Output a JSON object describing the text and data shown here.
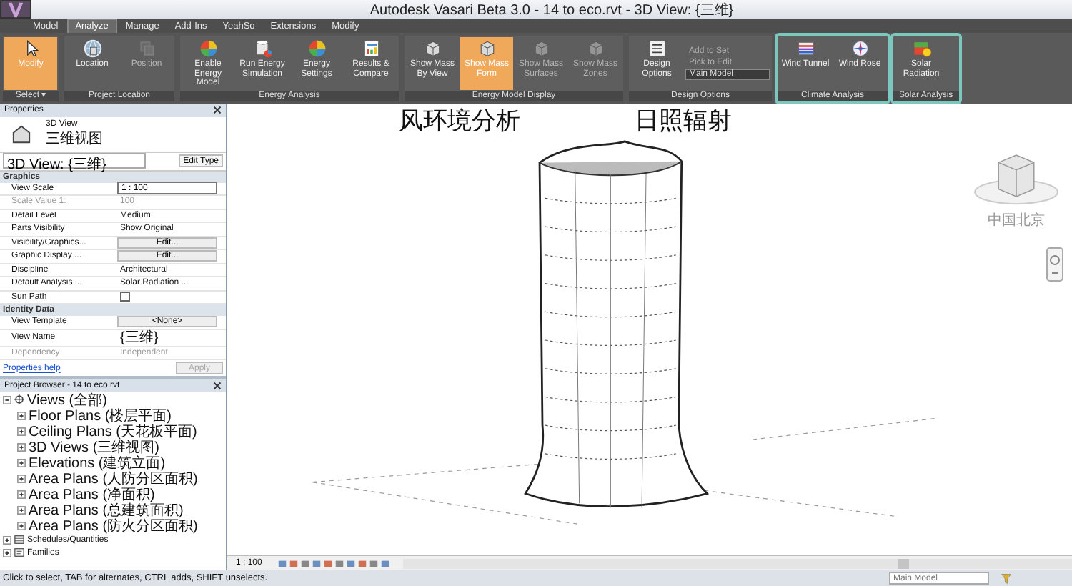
{
  "window": {
    "title": "Autodesk Vasari Beta 3.0 -     14 to eco.rvt - 3D View: {三维}"
  },
  "ribbon_tabs": [
    {
      "label": "Model",
      "selected": false
    },
    {
      "label": "Analyze",
      "selected": true
    },
    {
      "label": "Manage",
      "selected": false
    },
    {
      "label": "Add-Ins",
      "selected": false
    },
    {
      "label": "YeahSo",
      "selected": false
    },
    {
      "label": "Extensions",
      "selected": false
    },
    {
      "label": "Modify",
      "selected": false
    }
  ],
  "ribbon_panels": [
    {
      "label": "Select ▾",
      "highlighted": false,
      "buttons": [
        {
          "kind": "large",
          "label": "Modify",
          "selected": true,
          "disabled": false
        }
      ]
    },
    {
      "label": "Project Location",
      "highlighted": false,
      "buttons": [
        {
          "kind": "large",
          "label": "Location",
          "selected": false,
          "disabled": false
        },
        {
          "kind": "large",
          "label": "Position",
          "selected": false,
          "disabled": true
        }
      ]
    },
    {
      "label": "Energy Analysis",
      "highlighted": false,
      "buttons": [
        {
          "kind": "large",
          "label": "Enable Energy Model",
          "selected": false,
          "disabled": false
        },
        {
          "kind": "large",
          "label": "Run Energy Simulation",
          "selected": false,
          "disabled": false
        },
        {
          "kind": "large",
          "label": "Energy Settings",
          "selected": false,
          "disabled": false
        },
        {
          "kind": "large",
          "label": "Results & Compare",
          "selected": false,
          "disabled": false
        }
      ]
    },
    {
      "label": "Energy Model Display",
      "highlighted": false,
      "buttons": [
        {
          "kind": "large",
          "label": "Show Mass By View",
          "selected": false,
          "disabled": false
        },
        {
          "kind": "large",
          "label": "Show Mass Form",
          "selected": true,
          "disabled": false
        },
        {
          "kind": "large",
          "label": "Show Mass Surfaces",
          "selected": false,
          "disabled": true
        },
        {
          "kind": "large",
          "label": "Show Mass Zones",
          "selected": false,
          "disabled": true
        }
      ]
    },
    {
      "label": "Design Options",
      "highlighted": false,
      "buttons": [
        {
          "kind": "large",
          "label": "Design Options",
          "selected": false,
          "disabled": false
        },
        {
          "kind": "small",
          "label": "Add to Set",
          "disabled": true
        },
        {
          "kind": "small",
          "label": "Pick to Edit",
          "disabled": true
        },
        {
          "kind": "dropdown",
          "label": "Main Model"
        }
      ]
    },
    {
      "label": "Climate Analysis",
      "highlighted": true,
      "buttons": [
        {
          "kind": "large",
          "label": "Wind Tunnel",
          "selected": false,
          "disabled": false
        },
        {
          "kind": "large",
          "label": "Wind Rose",
          "selected": false,
          "disabled": false
        }
      ]
    },
    {
      "label": "Solar Analysis",
      "highlighted": true,
      "buttons": [
        {
          "kind": "large",
          "label": "Solar Radiation",
          "selected": false,
          "disabled": false
        }
      ]
    }
  ],
  "annotations": [
    {
      "text": "风环境分析"
    },
    {
      "text": "日照辐射"
    }
  ],
  "properties": {
    "title": "Properties",
    "type_name": "3D View",
    "type_subname": "三维视图",
    "instance": "3D View: {三维}",
    "edit_type": "Edit Type",
    "groups": [
      {
        "label": "Graphics",
        "rows": [
          {
            "label": "View Scale",
            "value": "1 : 100",
            "kind": "input",
            "disabled": false
          },
          {
            "label": "Scale Value    1:",
            "value": "100",
            "kind": "text",
            "disabled": true
          },
          {
            "label": "Detail Level",
            "value": "Medium",
            "kind": "text",
            "disabled": false
          },
          {
            "label": "Parts Visibility",
            "value": "Show Original",
            "kind": "text",
            "disabled": false
          },
          {
            "label": "Visibility/Graphics...",
            "value": "Edit...",
            "kind": "button",
            "disabled": false
          },
          {
            "label": "Graphic Display ...",
            "value": "Edit...",
            "kind": "button",
            "disabled": false
          },
          {
            "label": "Discipline",
            "value": "Architectural",
            "kind": "text",
            "disabled": false
          },
          {
            "label": "Default Analysis ...",
            "value": "Solar Radiation ...",
            "kind": "text",
            "disabled": false
          },
          {
            "label": "Sun Path",
            "kind": "checkbox",
            "checked": false,
            "disabled": false
          }
        ]
      },
      {
        "label": "Identity Data",
        "rows": [
          {
            "label": "View Template",
            "value": "<None>",
            "kind": "button",
            "disabled": false
          },
          {
            "label": "View Name",
            "value": "{三维}",
            "kind": "text",
            "disabled": false
          },
          {
            "label": "Dependency",
            "value": "Independent",
            "kind": "text",
            "disabled": true
          }
        ]
      }
    ],
    "help_link": "Properties help",
    "apply": {
      "label": "Apply",
      "disabled": true
    }
  },
  "project_browser": {
    "title": "Project Browser - 14 to eco.rvt",
    "items": [
      {
        "label": "Views (全部)",
        "kind": "views",
        "expanded": true,
        "children": [
          {
            "label": "Floor Plans (楼层平面)",
            "expanded": false
          },
          {
            "label": "Ceiling Plans (天花板平面)",
            "expanded": false
          },
          {
            "label": "3D Views (三维视图)",
            "expanded": false
          },
          {
            "label": "Elevations (建筑立面)",
            "expanded": false
          },
          {
            "label": "Area Plans (人防分区面积)",
            "expanded": false
          },
          {
            "label": "Area Plans (净面积)",
            "expanded": false
          },
          {
            "label": "Area Plans (总建筑面积)",
            "expanded": false
          },
          {
            "label": "Area Plans (防火分区面积)",
            "expanded": false
          }
        ]
      },
      {
        "label": "Schedules/Quantities",
        "kind": "schedules",
        "expanded": false
      },
      {
        "label": "Families",
        "kind": "families",
        "expanded": false
      }
    ]
  },
  "viewcube": {
    "location": "中国北京"
  },
  "view_bar": {
    "scale": "1 : 100"
  },
  "status_bar": {
    "message": "Click to select, TAB for alternates, CTRL adds, SHIFT unselects.",
    "model": "Main Model"
  }
}
